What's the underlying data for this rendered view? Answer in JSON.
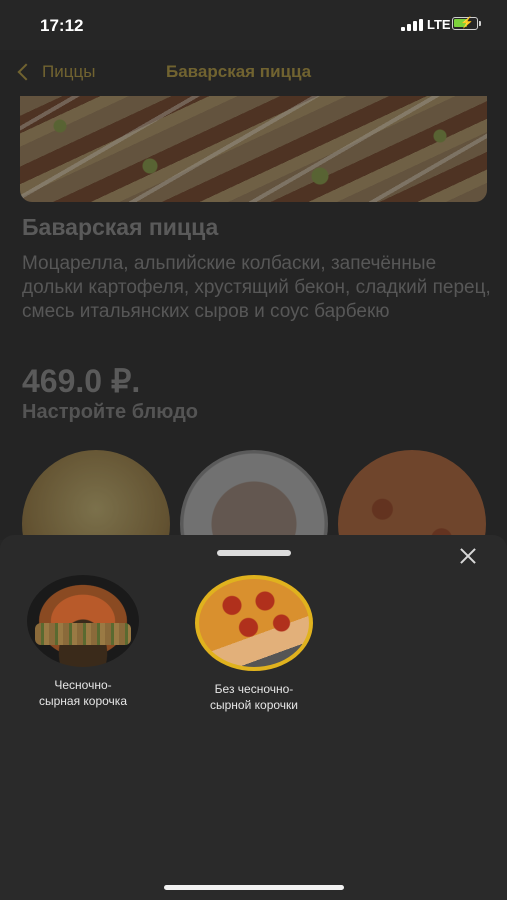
{
  "status_bar": {
    "time": "17:12",
    "network": "LTE"
  },
  "nav": {
    "back_label": "Пиццы",
    "title": "Баварская пицца"
  },
  "product": {
    "name": "Баварская пицца",
    "description": "Моцарелла, альпийские колбаски, запечённые дольки картофеля, хрустящий бекон, сладкий перец, смесь итальянских сыров и соус барбекю",
    "price": "469.0 ₽.",
    "configure_label": "Настройте блюдо"
  },
  "sheet": {
    "options": [
      {
        "label": "Чесночно-\nсырная корочка",
        "selected": false
      },
      {
        "label": "Без чесночно-\nсырной корочки",
        "selected": true
      }
    ]
  },
  "colors": {
    "accent": "#e0b21e",
    "nav_text": "#8c7a36",
    "sheet_bg": "#2a2a2a"
  }
}
